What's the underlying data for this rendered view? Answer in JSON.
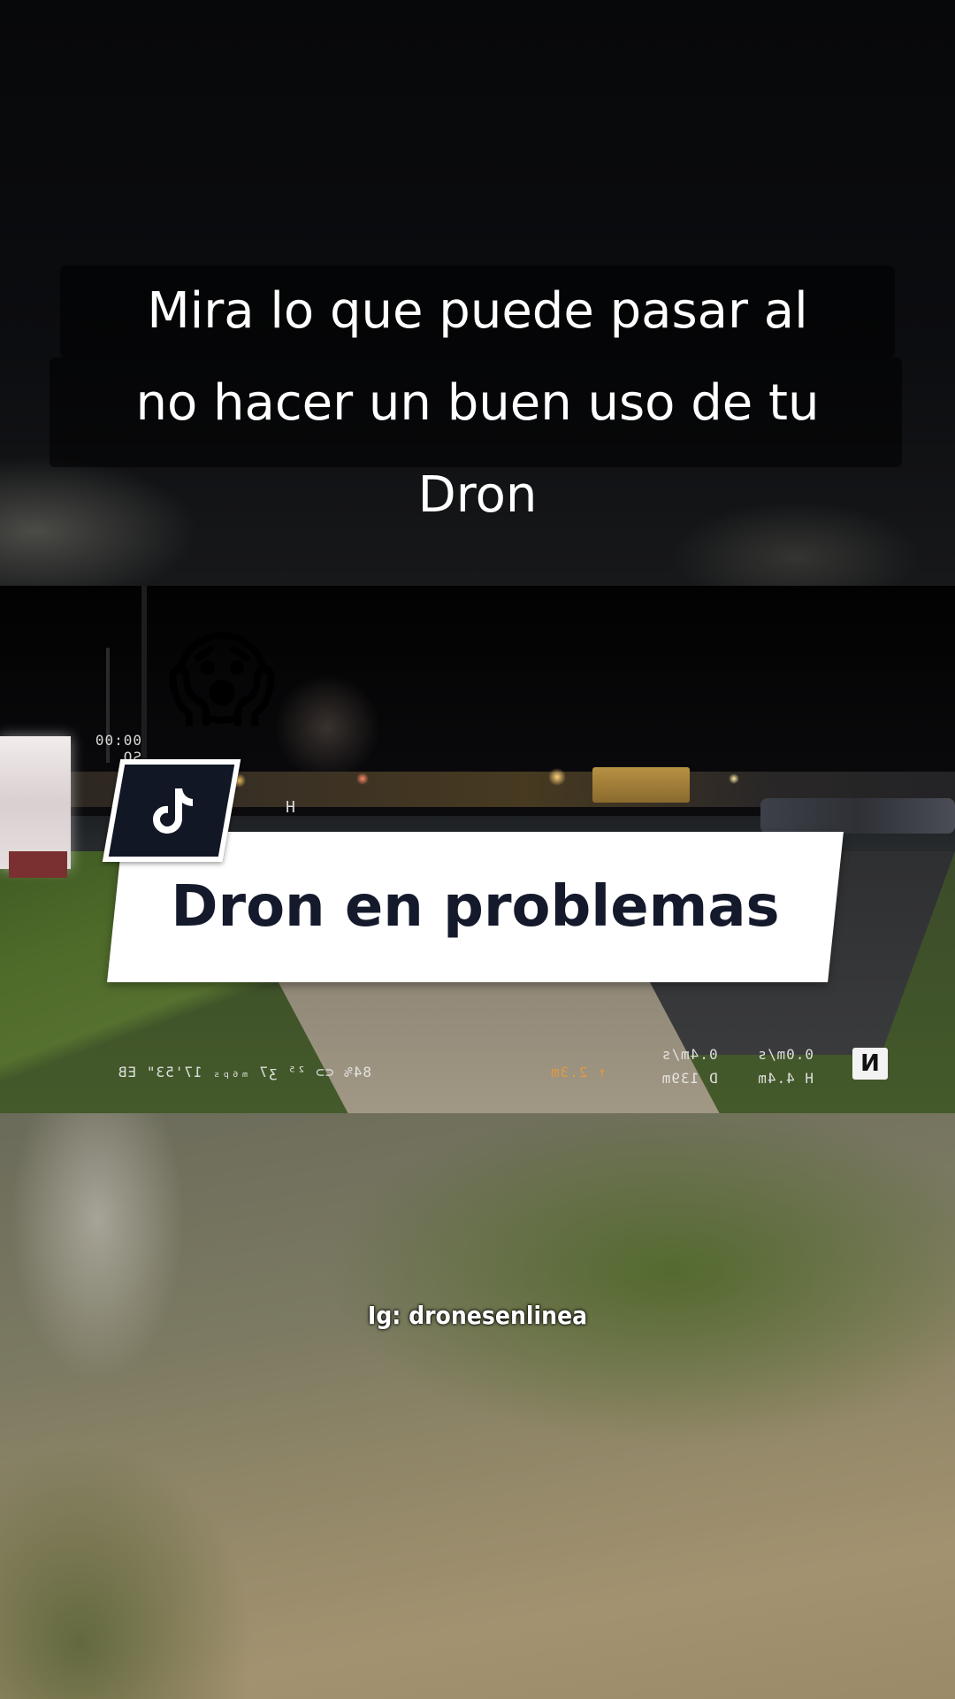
{
  "caption": {
    "line1": "Mira lo que puede pasar al",
    "line2": "no hacer un buen uso de tu",
    "line3": "Dron"
  },
  "sticker": {
    "title": "Dron en problemas",
    "logo_icon": "tiktok-logo-icon",
    "emoji_icon": "face-screaming-in-fear-icon",
    "emoji": "😱"
  },
  "video_hud": {
    "bottom_left": "84% ⊂⊃ ²⁵ ʒ7 ₘ₆ₚₛ 17'53\" EB",
    "altitude_orange": "↑ 2.3m",
    "distance": "D 139m",
    "height": "H 4.4m",
    "speed_left": "0.4m/s",
    "speed_right": "0.0m/s",
    "top_left_timer": "00:00",
    "top_left_mode": "SO",
    "horizon_marker": "H",
    "north": "N"
  },
  "watermark": {
    "text": "Ig: dronesenlinea"
  },
  "colors": {
    "plate": "#ffffff",
    "title_text": "#14192b",
    "logo_bg": "#121726",
    "hud_orange": "#e59a3e"
  }
}
